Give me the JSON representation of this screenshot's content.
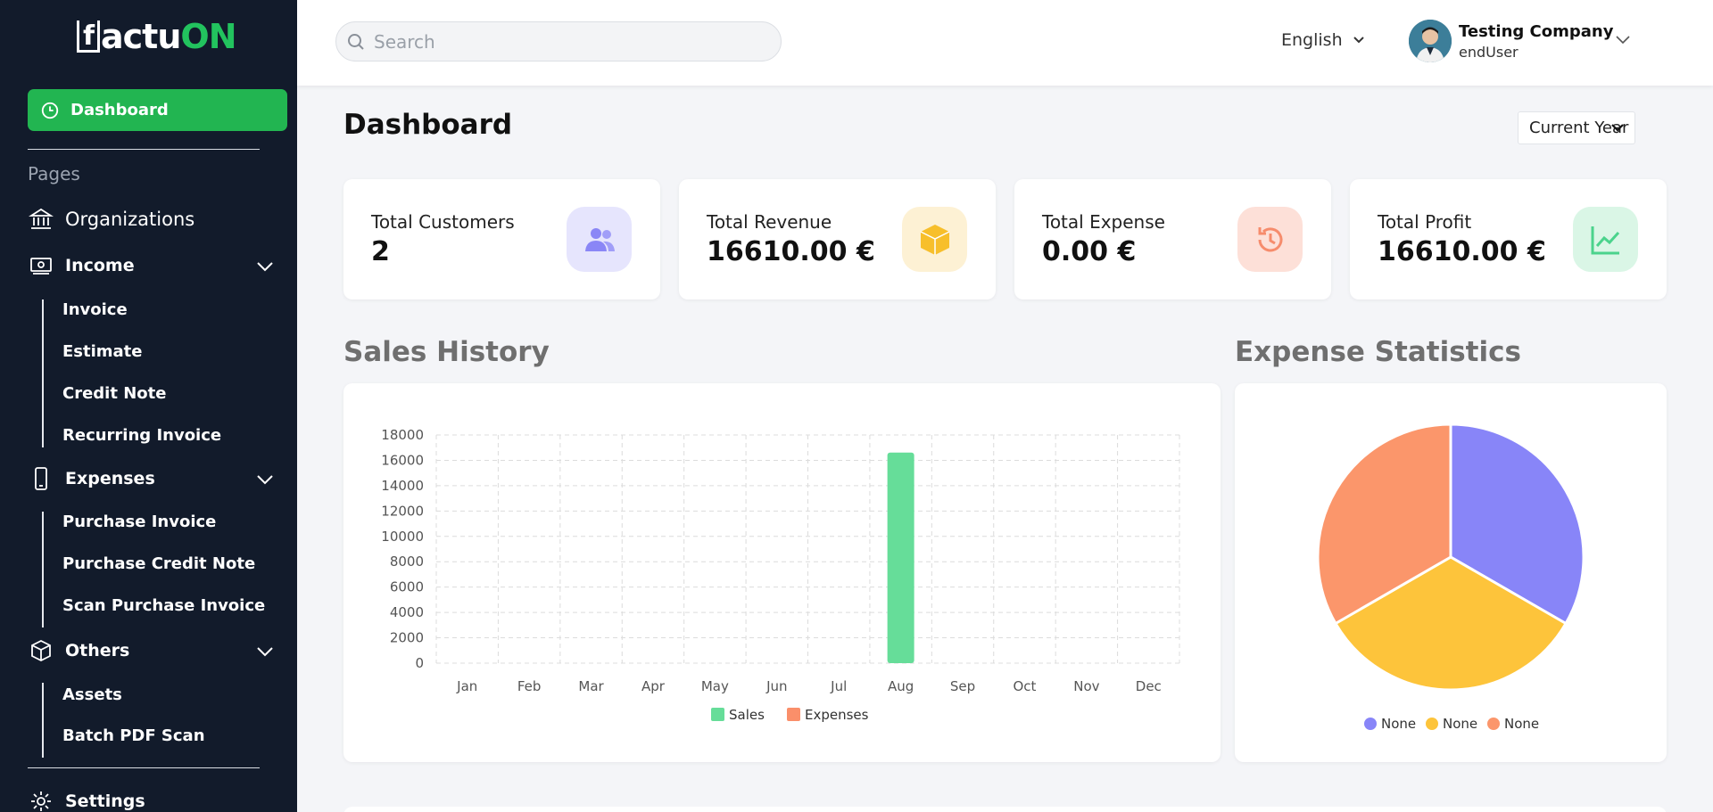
{
  "brand": {
    "logo_prefix": "f",
    "logo_mid": "actu",
    "logo_suffix": "ON",
    "accent": "#22c35e"
  },
  "sidebar": {
    "dashboard_label": "Dashboard",
    "pages_label": "Pages",
    "organizations": "Organizations",
    "income": {
      "label": "Income",
      "items": [
        "Invoice",
        "Estimate",
        "Credit Note",
        "Recurring Invoice"
      ]
    },
    "expenses": {
      "label": "Expenses",
      "items": [
        "Purchase Invoice",
        "Purchase Credit Note",
        "Scan Purchase Invoice"
      ]
    },
    "others": {
      "label": "Others",
      "items": [
        "Assets",
        "Batch PDF Scan"
      ]
    },
    "settings": "Settings"
  },
  "header": {
    "search_placeholder": "Search",
    "language": "English",
    "user_name": "Testing Company",
    "user_role": "endUser"
  },
  "main": {
    "title": "Dashboard",
    "period": "Current Year",
    "cards": [
      {
        "label": "Total Customers",
        "value": "2",
        "icon": "users-icon",
        "bg": "#e6e5fd",
        "fg": "#8a86f6"
      },
      {
        "label": "Total Revenue",
        "value": "16610.00 €",
        "icon": "box-icon",
        "bg": "#fdf1d4",
        "fg": "#f7bf2b"
      },
      {
        "label": "Total Expense",
        "value": "0.00 €",
        "icon": "history-icon",
        "bg": "#fde0d8",
        "fg": "#f68c6c"
      },
      {
        "label": "Total Profit",
        "value": "16610.00 €",
        "icon": "trend-icon",
        "bg": "#daf6e6",
        "fg": "#4bd38c"
      }
    ],
    "sales_title": "Sales History",
    "expense_title": "Expense Statistics"
  },
  "chart_data": [
    {
      "type": "bar",
      "title": "Sales History",
      "categories": [
        "Jan",
        "Feb",
        "Mar",
        "Apr",
        "May",
        "Jun",
        "Jul",
        "Aug",
        "Sep",
        "Oct",
        "Nov",
        "Dec"
      ],
      "series": [
        {
          "name": "Sales",
          "color": "#66dd99",
          "values": [
            0,
            0,
            0,
            0,
            0,
            0,
            0,
            16610,
            0,
            0,
            0,
            0
          ]
        },
        {
          "name": "Expenses",
          "color": "#fa8f6a",
          "values": [
            0,
            0,
            0,
            0,
            0,
            0,
            0,
            0,
            0,
            0,
            0,
            0
          ]
        }
      ],
      "ylim": [
        0,
        18000
      ],
      "yticks": [
        0,
        2000,
        4000,
        6000,
        8000,
        10000,
        12000,
        14000,
        16000,
        18000
      ],
      "grid": true,
      "legend": "bottom"
    },
    {
      "type": "pie",
      "title": "Expense Statistics",
      "labels": [
        "None",
        "None",
        "None"
      ],
      "values": [
        1,
        1,
        1
      ],
      "colors": [
        "#8885f8",
        "#fdc43b",
        "#fb966b"
      ],
      "legend": "bottom"
    }
  ]
}
